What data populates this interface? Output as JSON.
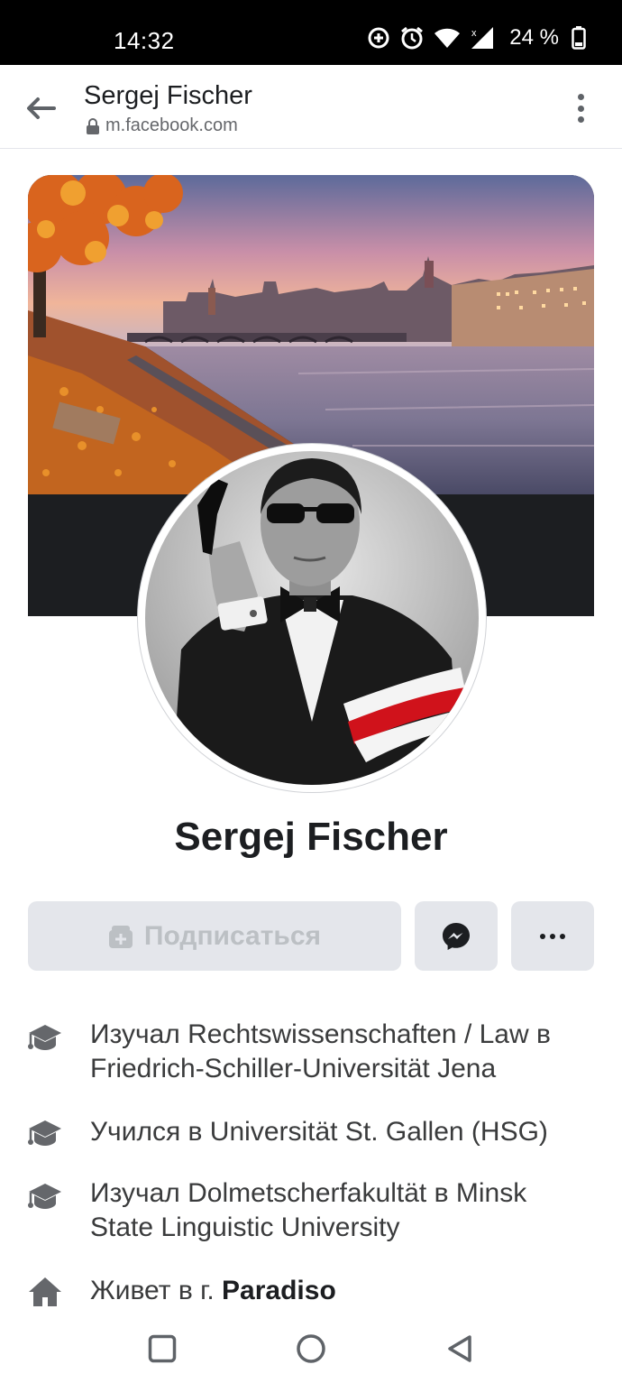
{
  "status_bar": {
    "time": "14:32",
    "battery": "24 %",
    "icons": [
      "data-saver-icon",
      "alarm-icon",
      "wifi-icon",
      "signal-icon",
      "battery-icon"
    ]
  },
  "browser": {
    "title": "Sergej Fischer",
    "url": "m.facebook.com"
  },
  "profile": {
    "name": "Sergej Fischer",
    "actions": {
      "subscribe_label": "Подписаться"
    },
    "info": [
      {
        "icon": "education-icon",
        "text": "Изучал Rechtswissenschaften / Law в Friedrich-Schiller-Universität Jena"
      },
      {
        "icon": "education-icon",
        "text": "Учился в Universität St. Gallen (HSG)"
      },
      {
        "icon": "education-icon",
        "text": "Изучал Dolmetscherfakultät в Minsk State Linguistic University"
      },
      {
        "icon": "home-icon",
        "prefix": "Живет в г. ",
        "place": "Paradiso"
      }
    ]
  },
  "colors": {
    "button_bg": "#e4e6eb",
    "disabled_text": "#bcc0c4",
    "primary_text": "#1c1e21",
    "secondary_text": "#65676b"
  }
}
